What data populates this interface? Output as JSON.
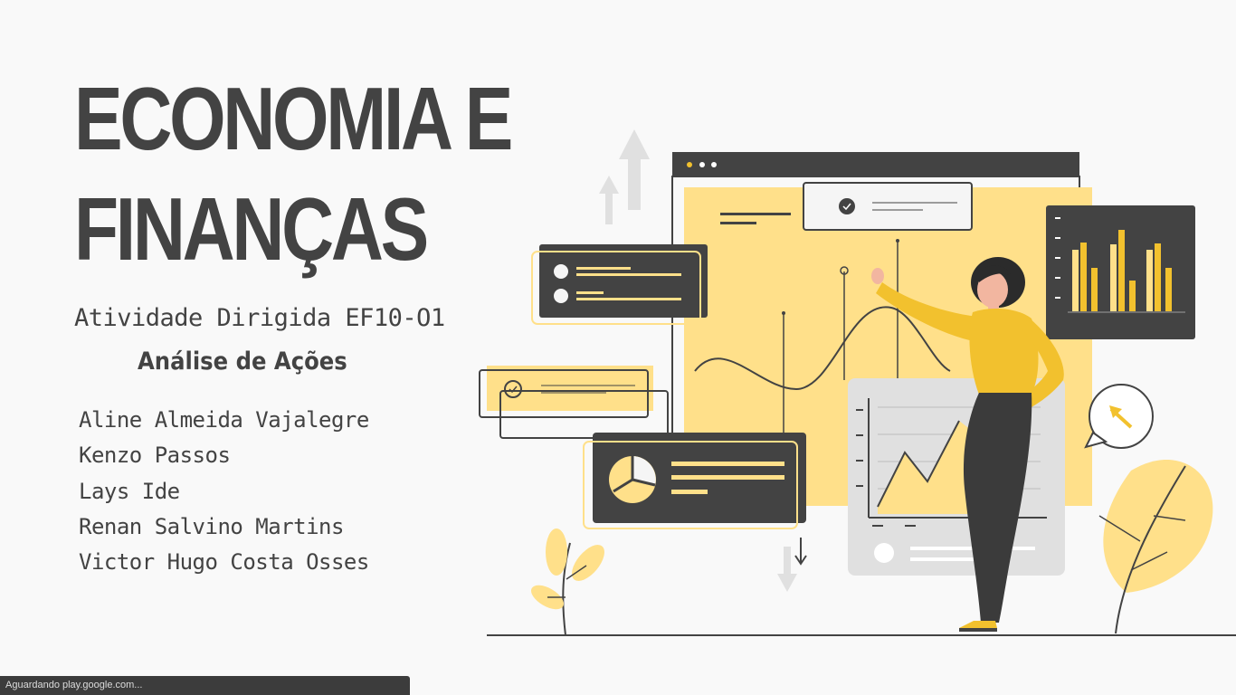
{
  "slide": {
    "title_lines": [
      "ECONOMIA E",
      "FINANÇAS"
    ],
    "subtitle": "Atividade Dirigida EF10-O1",
    "section": "Análise de Ações",
    "authors": [
      "Aline Almeida Vajalegre",
      "Kenzo Passos",
      "Lays Ide",
      "Renan Salvino Martins",
      "Victor Hugo Costa Osses"
    ]
  },
  "status_bar": {
    "text": "Aguardando play.google.com..."
  },
  "illustration": {
    "name": "business-analytics-illustration",
    "colors": {
      "dark": "#434343",
      "yellow": "#ffe08a",
      "accent": "#f2c12e",
      "light_gray": "#e0e0e0"
    }
  }
}
